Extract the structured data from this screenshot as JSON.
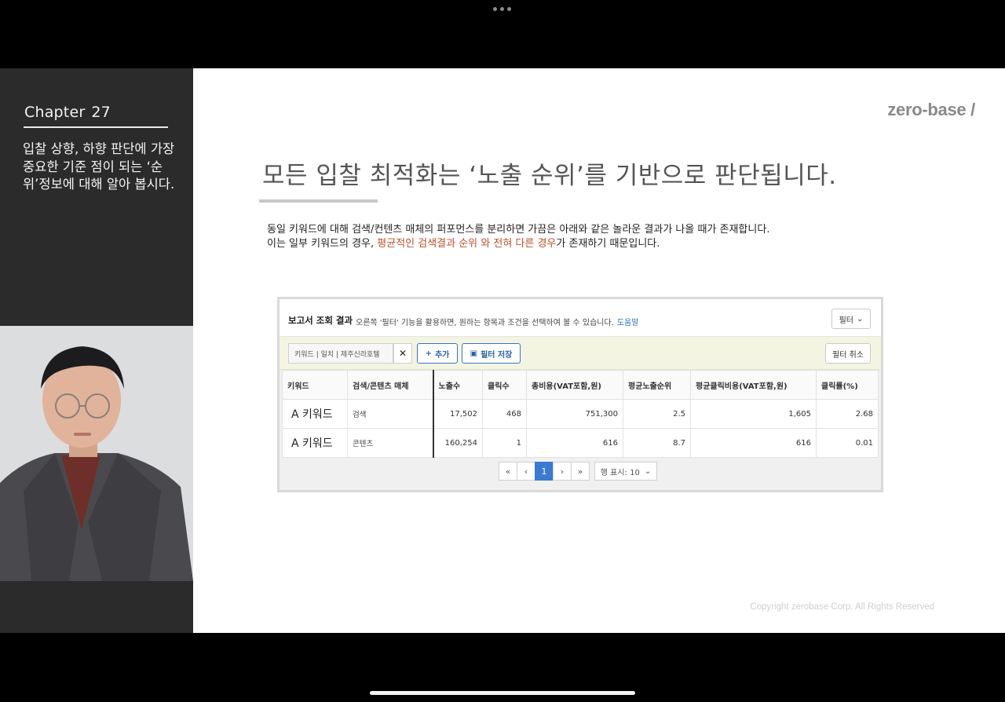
{
  "left_panel": {
    "chapter_word": "Chapter",
    "chapter_number": "27",
    "description": "입찰 상향, 하향 판단에 가장 중요한 기준 점이 되는 ‘순위’정보에 대해 알아 봅시다."
  },
  "slide": {
    "brand": "zero-base /",
    "title": "모든 입찰 최적화는 ‘노출 순위’를 기반으로 판단됩니다.",
    "body_line1": "동일 키워드에 대해 검색/컨텐츠 매체의 퍼포먼스를 분리하면 가끔은 아래와 같은 놀라운 결과가 나올 때가 존재합니다.",
    "body_line2_prefix": "이는 일부 키워드의 경우,",
    "body_line2_highlight": "평균적인 검색결과 순위 와 전혀 다른 경우",
    "body_line2_suffix": "가 존재하기 때문입니다.",
    "highlight_color": "#c0502a",
    "copyright": "Copyright zerobase Corp. All Rights Reserved"
  },
  "report": {
    "title": "보고서 조회 결과",
    "description": "오른쪽 '필터' 기능을 활용하면, 원하는 항목과 조건을 선택하여 볼 수 있습니다.",
    "help_link": "도움말",
    "filter_dropdown": "필터",
    "filter_chip": "키워드 | 일치 | 제주신라호텔",
    "add_button": "추가",
    "save_filter_button": "필터 저장",
    "cancel_filter_button": "필터 취소",
    "columns": [
      "키워드",
      "검색/콘텐츠 매체",
      "노출수",
      "클릭수",
      "총비용(VAT포함,원)",
      "평균노출순위",
      "평균클릭비용(VAT포함,원)",
      "클릭률(%)"
    ],
    "rows": [
      [
        "A 키워드",
        "검색",
        "17,502",
        "468",
        "751,300",
        "2.5",
        "1,605",
        "2.68"
      ],
      [
        "A 키워드",
        "콘텐츠",
        "160,254",
        "1",
        "616",
        "8.7",
        "616",
        "0.01"
      ]
    ],
    "pager": {
      "first": "«",
      "prev": "‹",
      "current_page": "1",
      "next": "›",
      "last": "»",
      "rows_per_page": "행 표시: 10"
    }
  }
}
